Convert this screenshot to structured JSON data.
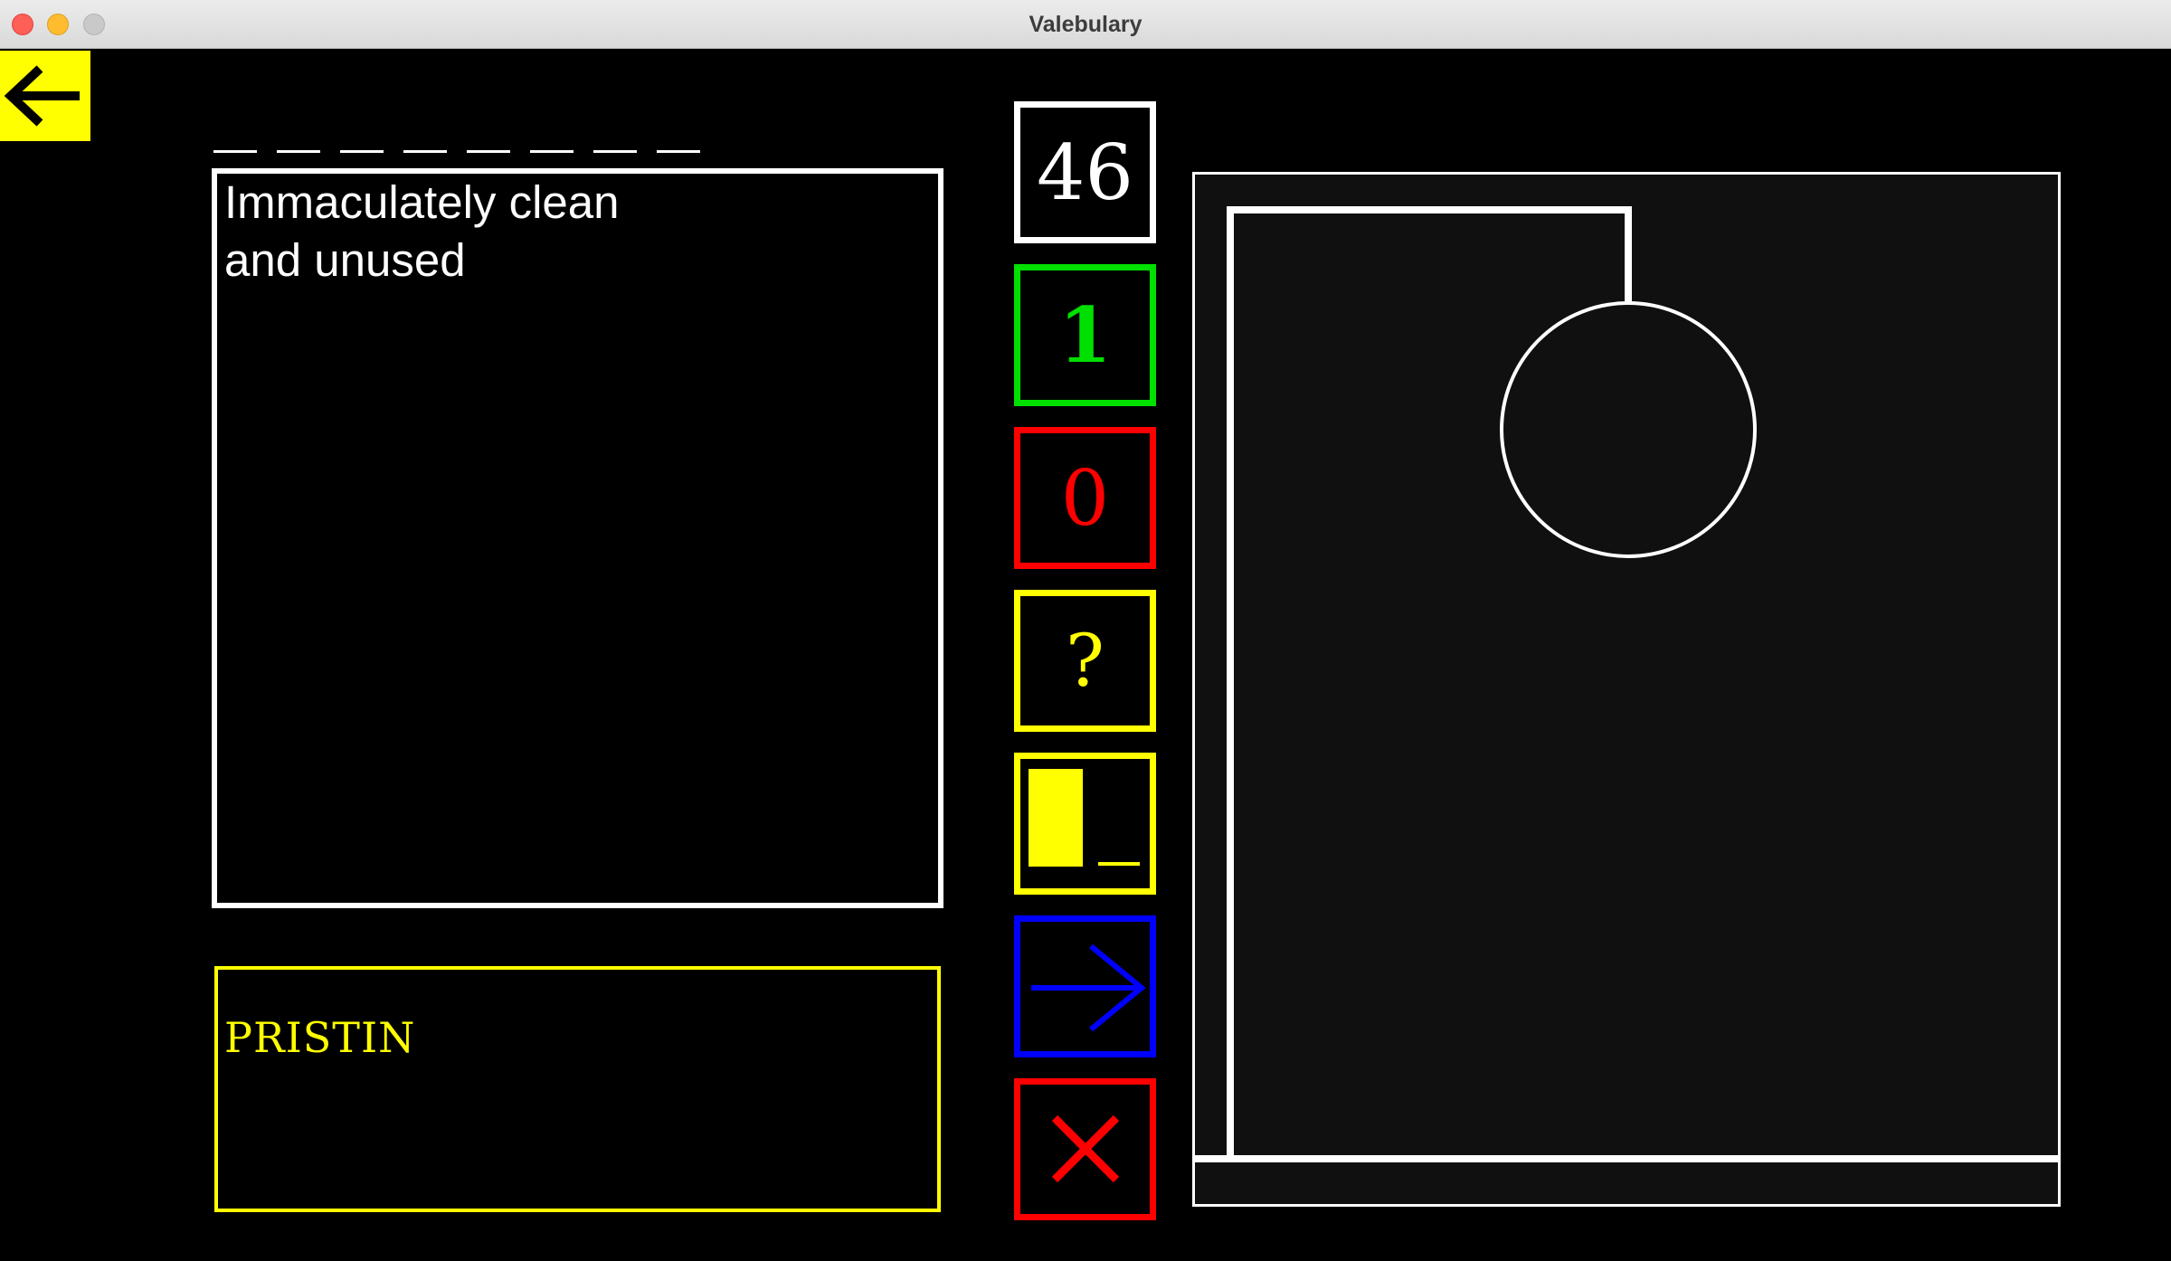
{
  "window": {
    "title": "Valebulary"
  },
  "word": {
    "letter_slots": 8,
    "clue": "Immaculately clean\nand unused",
    "guess": "PRISTIN"
  },
  "controls": {
    "score": "46",
    "correct_count": "1",
    "wrong_count": "0",
    "hint_label": "?"
  },
  "icons": {
    "back": "arrow-left-icon",
    "reveal": "reveal-letter-icon",
    "next": "arrow-right-icon",
    "quit": "close-icon"
  },
  "colors": {
    "background": "#000000",
    "accent_yellow": "#ffff00",
    "correct_green": "#00e000",
    "wrong_red": "#ff0000",
    "next_blue": "#0000ff",
    "panel": "#101010"
  },
  "hangman": {
    "wrong_guesses_shown": 0,
    "parts_drawn": [
      "gallows",
      "head"
    ]
  }
}
